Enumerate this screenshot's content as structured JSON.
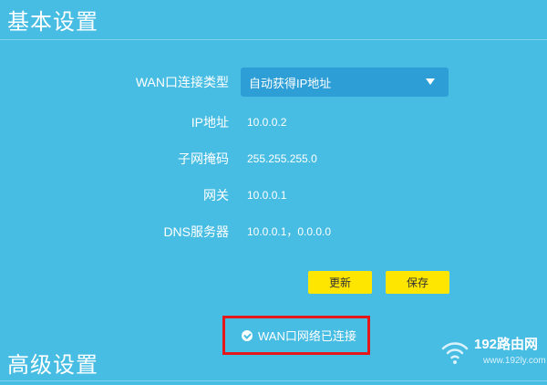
{
  "sections": {
    "basic_title": "基本设置",
    "advanced_title": "高级设置"
  },
  "wan": {
    "connection_type_label": "WAN口连接类型",
    "connection_type_value": "自动获得IP地址",
    "fields": [
      {
        "label": "IP地址",
        "value": "10.0.0.2"
      },
      {
        "label": "子网掩码",
        "value": "255.255.255.0"
      },
      {
        "label": "网关",
        "value": "10.0.0.1"
      },
      {
        "label": "DNS服务器",
        "value": "10.0.0.1，0.0.0.0"
      }
    ]
  },
  "buttons": {
    "refresh_label": "更新",
    "save_label": "保存"
  },
  "status": {
    "text": "WAN口网络已连接"
  },
  "watermark": {
    "brand": "192路由网",
    "url": "www.192ly.com"
  },
  "colors": {
    "background": "#48bde3",
    "select": "#2d9fd6",
    "button": "#ffe600",
    "highlight_border": "#e4171b"
  },
  "icons": {
    "dropdown": "caret-down-icon",
    "status": "check-circle-icon",
    "watermark": "wifi-icon"
  }
}
